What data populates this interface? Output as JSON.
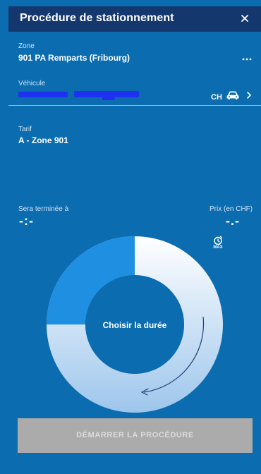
{
  "header": {
    "title": "Procédure de stationnement",
    "close_glyph": "×"
  },
  "zone": {
    "label": "Zone",
    "value": "901 PA Remparts (Fribourg)",
    "more_icon": "more-dots-icon"
  },
  "vehicle": {
    "label": "Véhicule",
    "country": "CH",
    "car_icon": "car-icon",
    "chevron_icon": "chevron-right-icon"
  },
  "tariff": {
    "label": "Tarif",
    "value": "A - Zone 901"
  },
  "summary": {
    "end_label": "Sera terminée à",
    "end_value": "-:-",
    "price_label": "Prix (en CHF)",
    "price_value": "-.-",
    "max_label": "MAX"
  },
  "dial": {
    "label": "Choisir la durée"
  },
  "actions": {
    "start_label": "DÉMARRER LA PROCÉDURE"
  },
  "colors": {
    "background": "#0c6cb0",
    "header": "#14386e",
    "button_disabled": "#ababab"
  }
}
